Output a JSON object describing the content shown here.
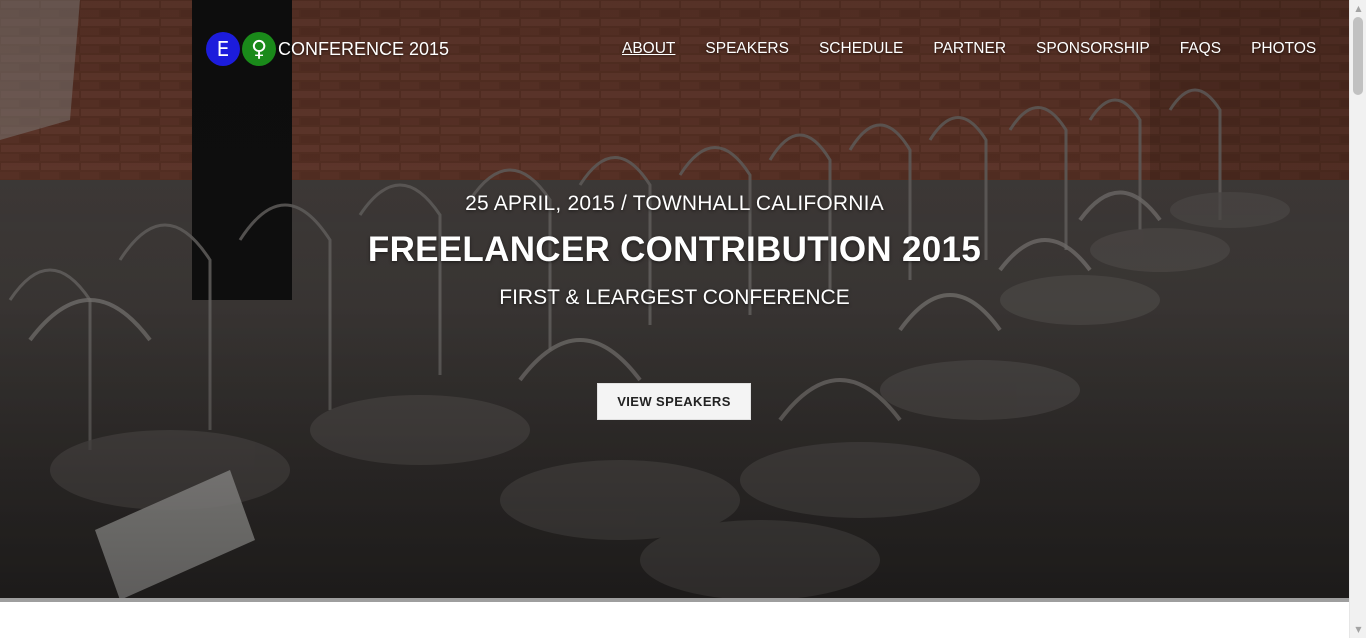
{
  "logo": {
    "badge_e": "E",
    "badge_symbol": "♀",
    "text": "CONFERENCE 2015",
    "colors": {
      "badge_e": "#1c1cdc",
      "badge_symbol": "#1a8a1a"
    }
  },
  "nav": {
    "items": [
      {
        "label": "ABOUT",
        "active": true
      },
      {
        "label": "SPEAKERS",
        "active": false
      },
      {
        "label": "SCHEDULE",
        "active": false
      },
      {
        "label": "PARTNER",
        "active": false
      },
      {
        "label": "SPONSORSHIP",
        "active": false
      },
      {
        "label": "FAQS",
        "active": false
      },
      {
        "label": "PHOTOS",
        "active": false
      }
    ]
  },
  "hero": {
    "date_location": "25 APRIL, 2015 / TOWNHALL CALIFORNIA",
    "title": "FREELANCER CONTRIBUTION 2015",
    "subtitle": "FIRST & LEARGEST CONFERENCE",
    "cta_label": "VIEW SPEAKERS",
    "background": "photo of rows of metal chairs in a brick-walled hall"
  },
  "scrollbar": {
    "up_icon": "triangle-up-icon",
    "down_icon": "triangle-down-icon"
  }
}
